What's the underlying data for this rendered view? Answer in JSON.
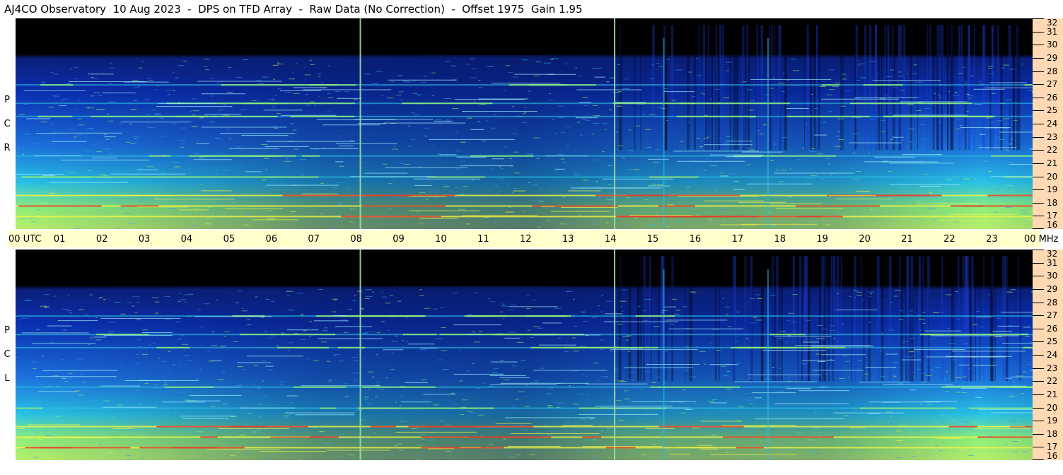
{
  "header": {
    "title": "AJ4CO Observatory  10 Aug 2023  -  DPS on TFD Array  -  Raw Data (No Correction)  -  Offset 1975  Gain 1.95"
  },
  "panels": {
    "top_label": [
      "R",
      "C",
      "P"
    ],
    "bottom_label": [
      "L",
      "C",
      "P"
    ]
  },
  "time_axis": {
    "utc_label": "UTC",
    "mhz_label": "MHz",
    "hours": [
      "00",
      "01",
      "02",
      "03",
      "04",
      "05",
      "06",
      "07",
      "08",
      "09",
      "10",
      "11",
      "12",
      "13",
      "14",
      "15",
      "16",
      "17",
      "18",
      "19",
      "20",
      "21",
      "22",
      "23",
      "00"
    ]
  },
  "freq_axis": {
    "ticks": [
      "32",
      "31",
      "30",
      "29",
      "28",
      "27",
      "26",
      "25",
      "24",
      "23",
      "22",
      "21",
      "20",
      "19",
      "18",
      "17",
      "16"
    ]
  },
  "colors": {
    "background_low": "#000000",
    "signal_blue": "#0a2fb0",
    "signal_cyan": "#29c3e6",
    "signal_green": "#8ef07a",
    "signal_yellow": "#f5f542",
    "signal_red": "#e33c2a",
    "freq_axis_bg": "#ffd9b3",
    "time_axis_bg": "#ffffcc"
  },
  "chart_data": {
    "type": "heatmap",
    "title": "AJ4CO Observatory  10 Aug 2023  -  DPS on TFD Array  -  Raw Data (No Correction)  -  Offset 1975  Gain 1.95",
    "xlabel": "UTC",
    "ylabel": "MHz",
    "xlim": [
      0,
      24
    ],
    "ylim": [
      16,
      32
    ],
    "panels": [
      "RCP",
      "LCP"
    ],
    "vertical_markers_utc": [
      8.12,
      14.12,
      15.28,
      17.74
    ],
    "persistent_bands_mhz": [
      17.0,
      17.8,
      18.6,
      20.0,
      21.6,
      24.6,
      25.6,
      27.0
    ],
    "black_region_above_mhz": 29.2
  }
}
